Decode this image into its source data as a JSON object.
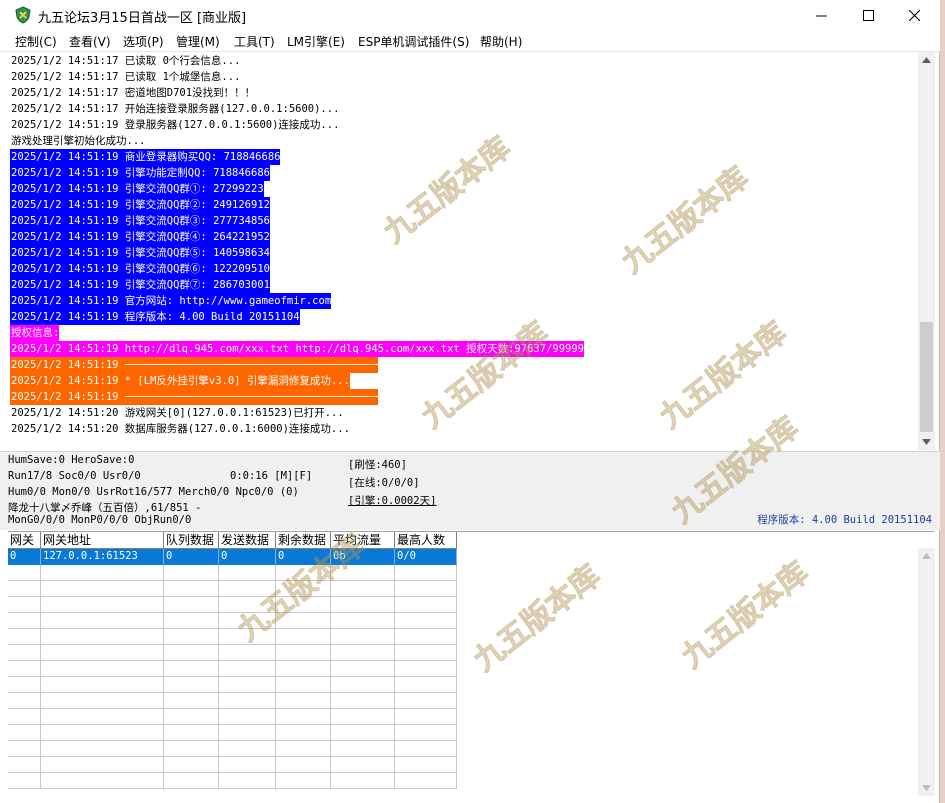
{
  "window": {
    "title": "九五论坛3月15日首战一区 [商业版]"
  },
  "titlebar": {
    "minimize_icon": "minimize-icon",
    "maximize_icon": "maximize-icon",
    "close_icon": "close-icon"
  },
  "menu": [
    {
      "label": "控制(C)"
    },
    {
      "label": "查看(V)"
    },
    {
      "label": "选项(P)"
    },
    {
      "label": "管理(M)"
    },
    {
      "label": "工具(T)"
    },
    {
      "label": "LM引擎(E)"
    },
    {
      "label": "ESP单机调试插件(S)"
    },
    {
      "label": "帮助(H)"
    }
  ],
  "log": [
    {
      "text": "2025/1/2 14:51:17 已读取 0个行会信息...",
      "bg": "#ffffff",
      "fg": "#000000"
    },
    {
      "text": "2025/1/2 14:51:17 已读取 1个城堡信息...",
      "bg": "#ffffff",
      "fg": "#000000"
    },
    {
      "text": "2025/1/2 14:51:17 密道地图D701没找到！！！",
      "bg": "#ffffff",
      "fg": "#000000"
    },
    {
      "text": "2025/1/2 14:51:17 开始连接登录服务器(127.0.0.1:5600)...",
      "bg": "#ffffff",
      "fg": "#000000"
    },
    {
      "text": "2025/1/2 14:51:19 登录服务器(127.0.0.1:5600)连接成功...",
      "bg": "#ffffff",
      "fg": "#000000"
    },
    {
      "text": "游戏处理引擎初始化成功...",
      "bg": "#ffffff",
      "fg": "#000000"
    },
    {
      "text": "2025/1/2 14:51:19 商业登录器购买QQ: 718846686",
      "bg": "#0000ff",
      "fg": "#ffffff"
    },
    {
      "text": "2025/1/2 14:51:19 引擎功能定制QQ: 718846686",
      "bg": "#0000ff",
      "fg": "#ffffff"
    },
    {
      "text": "2025/1/2 14:51:19 引擎交流QQ群①: 27299223",
      "bg": "#0000ff",
      "fg": "#ffffff"
    },
    {
      "text": "2025/1/2 14:51:19 引擎交流QQ群②: 249126912",
      "bg": "#0000ff",
      "fg": "#ffffff"
    },
    {
      "text": "2025/1/2 14:51:19 引擎交流QQ群③: 277734856",
      "bg": "#0000ff",
      "fg": "#ffffff"
    },
    {
      "text": "2025/1/2 14:51:19 引擎交流QQ群④: 264221952",
      "bg": "#0000ff",
      "fg": "#ffffff"
    },
    {
      "text": "2025/1/2 14:51:19 引擎交流QQ群⑤: 140598634",
      "bg": "#0000ff",
      "fg": "#ffffff"
    },
    {
      "text": "2025/1/2 14:51:19 引擎交流QQ群⑥: 122209510",
      "bg": "#0000ff",
      "fg": "#ffffff"
    },
    {
      "text": "2025/1/2 14:51:19 引擎交流QQ群⑦: 286703001",
      "bg": "#0000ff",
      "fg": "#ffffff"
    },
    {
      "text": "2025/1/2 14:51:19 官方网站: http://www.gameofmir.com",
      "bg": "#0000ff",
      "fg": "#ffffff"
    },
    {
      "text": "2025/1/2 14:51:19 程序版本: 4.00 Build 20151104",
      "bg": "#0000ff",
      "fg": "#ffffff"
    },
    {
      "text": "授权信息:",
      "bg": "#ff00ff",
      "fg": "#ffffff"
    },
    {
      "text": "2025/1/2 14:51:19 http://dlq.945.com/xxx.txt http://dlq.945.com/xxx.txt 授权天数:97637/99999",
      "bg": "#ff00ff",
      "fg": "#ffffff"
    },
    {
      "text": "2025/1/2 14:51:19 ────────────────────────────────────────",
      "bg": "#ff6600",
      "fg": "#ffffff"
    },
    {
      "text": "2025/1/2 14:51:19 * [LM反外挂引擎v3.0] 引擎漏洞修复成功...",
      "bg": "#ff6600",
      "fg": "#ffffff"
    },
    {
      "text": "2025/1/2 14:51:19 ────────────────────────────────────────",
      "bg": "#ff6600",
      "fg": "#ffffff"
    },
    {
      "text": "2025/1/2 14:51:20 游戏网关[0](127.0.0.1:61523)已打开...",
      "bg": "#ffffff",
      "fg": "#000000"
    },
    {
      "text": "2025/1/2 14:51:20 数据库服务器(127.0.0.1:6000)连接成功...",
      "bg": "#ffffff",
      "fg": "#000000"
    }
  ],
  "status": {
    "line1": "HumSave:0 HeroSave:0",
    "line2": "Run17/8 Soc0/0 Usr0/0",
    "timer": "0:0:16 [M][F]",
    "line3": "Hum0/0 Mon0/0 UsrRot16/577 Merch0/0 Npc0/0 (0)",
    "line4": "降龙十八掌〆乔峰（五百倍）,61/851 -",
    "line5": "MonG0/0/0 MonP0/0/0 ObjRun0/0",
    "refresh_monsters": "[刷怪:460]",
    "online": "[在线:0/0/0]",
    "engine": "[引擎:0.0002天]",
    "version": "程序版本: 4.00 Build 20151104"
  },
  "gate_table": {
    "columns": [
      "网关",
      "网关地址",
      "队列数据",
      "发送数据",
      "剩余数据",
      "平均流量",
      "最高人数"
    ],
    "rows": [
      [
        "0",
        "127.0.0.1:61523",
        "0",
        "0",
        "0",
        "0b",
        "0/0"
      ]
    ]
  },
  "colors": {
    "selection": "#0a78d7",
    "version_text": "#1c3f9c"
  },
  "icons": {
    "app": "app-shield-icon",
    "watermark": "watermark-logo"
  },
  "watermark": {
    "text": "九五版本库"
  }
}
